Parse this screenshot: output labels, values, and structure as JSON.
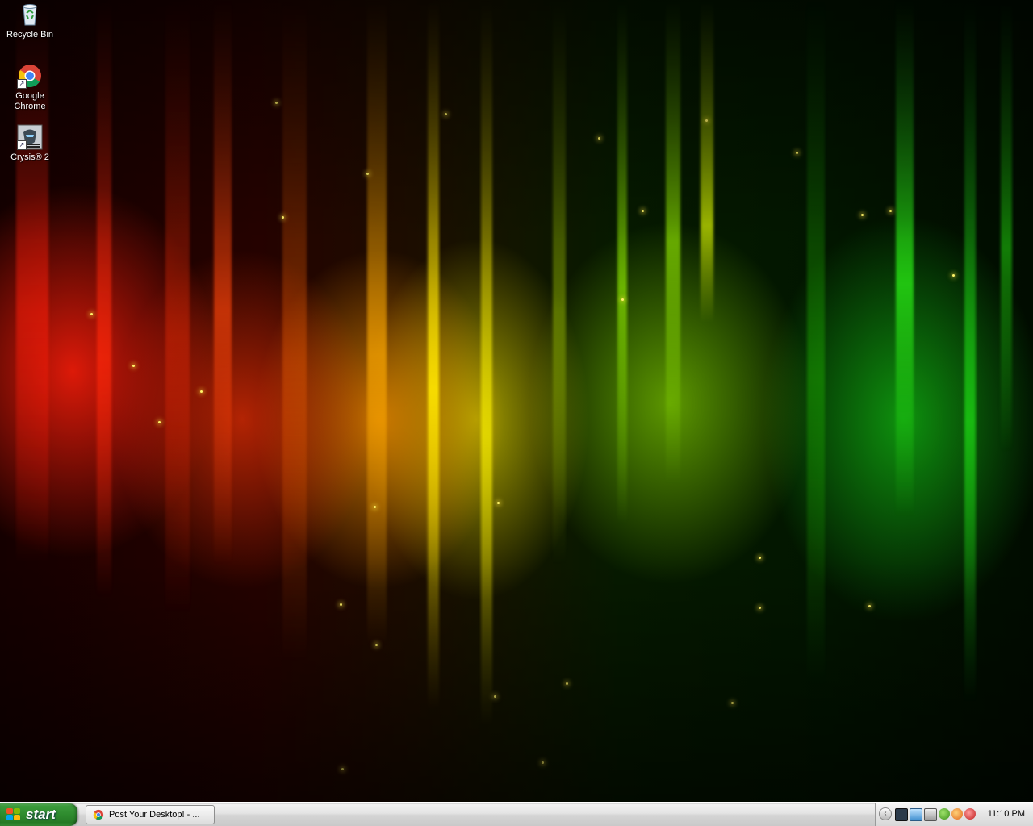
{
  "desktop": {
    "icons": [
      {
        "label": "Recycle Bin",
        "icon": "recycle-bin-icon"
      },
      {
        "label": "Google Chrome",
        "icon": "chrome-icon"
      },
      {
        "label": "Crysis® 2",
        "icon": "crysis-icon"
      }
    ]
  },
  "taskbar": {
    "start_label": "start",
    "tasks": [
      {
        "label": "Post Your Desktop! - ...",
        "icon": "chrome-icon"
      }
    ],
    "tray": {
      "icons": [
        "show-hidden-icons-chevron",
        "steam-icon",
        "network-icon",
        "volume-icon",
        "messenger-icon",
        "antivirus-icon",
        "update-icon"
      ],
      "clock": "11:10 PM"
    }
  },
  "colors": {
    "taskbar_bg": "#d9d9d9",
    "start_green": "#2e8b2e",
    "wallpaper_red": "#ff1e0a",
    "wallpaper_yellow": "#e6dc00",
    "wallpaper_green": "#14c814"
  }
}
